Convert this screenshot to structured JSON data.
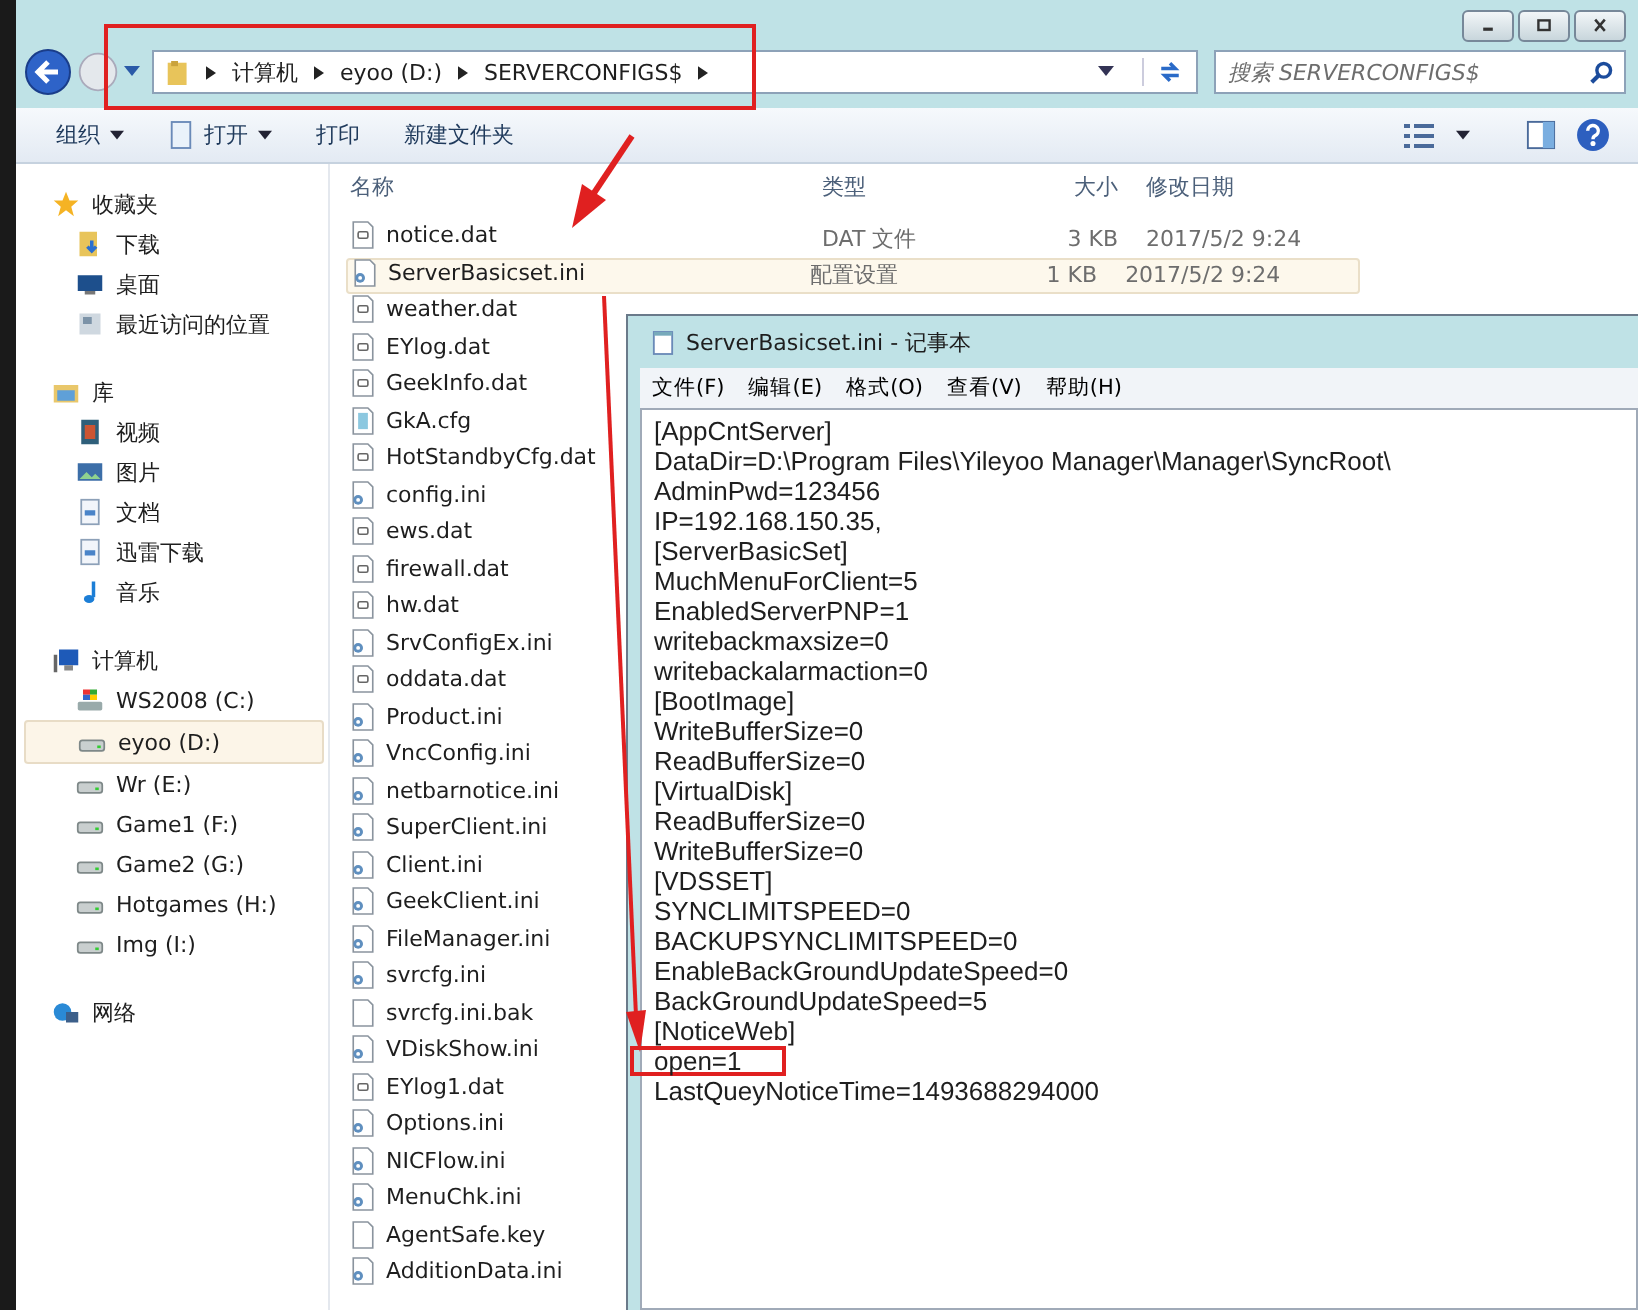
{
  "address_bar": {
    "crumbs": [
      "计算机",
      "eyoo (D:)",
      "SERVERCONFIGS$"
    ]
  },
  "search": {
    "placeholder": "搜索 SERVERCONFIGS$"
  },
  "toolbar": [
    {
      "label": "组织",
      "dropdown": true,
      "kind": "plain"
    },
    {
      "label": "打开",
      "dropdown": true,
      "kind": "open"
    },
    {
      "label": "打印",
      "dropdown": false,
      "kind": "plain"
    },
    {
      "label": "新建文件夹",
      "dropdown": false,
      "kind": "plain"
    }
  ],
  "sidebar": {
    "groups": [
      {
        "label": "收藏夹",
        "kind": "star",
        "items": [
          {
            "label": "下载",
            "kind": "download",
            "selected": false
          },
          {
            "label": "桌面",
            "kind": "desktop",
            "selected": false
          },
          {
            "label": "最近访问的位置",
            "kind": "recent",
            "selected": false
          }
        ]
      },
      {
        "label": "库",
        "kind": "library",
        "items": [
          {
            "label": "视频",
            "kind": "video",
            "selected": false
          },
          {
            "label": "图片",
            "kind": "picture",
            "selected": false
          },
          {
            "label": "文档",
            "kind": "document",
            "selected": false
          },
          {
            "label": "迅雷下载",
            "kind": "document",
            "selected": false
          },
          {
            "label": "音乐",
            "kind": "music",
            "selected": false
          }
        ]
      },
      {
        "label": "计算机",
        "kind": "computer",
        "items": [
          {
            "label": "WS2008 (C:)",
            "kind": "system-drive",
            "selected": false
          },
          {
            "label": "eyoo (D:)",
            "kind": "drive",
            "selected": true
          },
          {
            "label": "Wr (E:)",
            "kind": "drive",
            "selected": false
          },
          {
            "label": "Game1 (F:)",
            "kind": "drive",
            "selected": false
          },
          {
            "label": "Game2 (G:)",
            "kind": "drive",
            "selected": false
          },
          {
            "label": "Hotgames (H:)",
            "kind": "drive",
            "selected": false
          },
          {
            "label": "Img (I:)",
            "kind": "drive",
            "selected": false
          }
        ]
      },
      {
        "label": "网络",
        "kind": "network"
      }
    ]
  },
  "table": {
    "columns": [
      "名称",
      "类型",
      "大小",
      "修改日期"
    ],
    "rows": [
      {
        "name": "notice.dat",
        "kind": "dat",
        "type": "DAT 文件",
        "size": "3 KB",
        "date": "2017/5/2 9:24",
        "selected": false
      },
      {
        "name": "ServerBasicset.ini",
        "kind": "ini",
        "type": "配置设置",
        "size": "1 KB",
        "date": "2017/5/2 9:24",
        "selected": true
      },
      {
        "name": "weather.dat",
        "kind": "dat",
        "selected": false
      },
      {
        "name": "EYlog.dat",
        "kind": "dat",
        "selected": false
      },
      {
        "name": "GeekInfo.dat",
        "kind": "dat",
        "selected": false
      },
      {
        "name": "GkA.cfg",
        "kind": "cfg",
        "selected": false
      },
      {
        "name": "HotStandbyCfg.dat",
        "kind": "dat",
        "selected": false
      },
      {
        "name": "config.ini",
        "kind": "ini",
        "selected": false
      },
      {
        "name": "ews.dat",
        "kind": "dat",
        "selected": false
      },
      {
        "name": "firewall.dat",
        "kind": "dat",
        "selected": false
      },
      {
        "name": "hw.dat",
        "kind": "dat",
        "selected": false
      },
      {
        "name": "SrvConfigEx.ini",
        "kind": "ini",
        "selected": false
      },
      {
        "name": "oddata.dat",
        "kind": "dat",
        "selected": false
      },
      {
        "name": "Product.ini",
        "kind": "ini",
        "selected": false
      },
      {
        "name": "VncConfig.ini",
        "kind": "ini",
        "selected": false
      },
      {
        "name": "netbarnotice.ini",
        "kind": "ini",
        "selected": false
      },
      {
        "name": "SuperClient.ini",
        "kind": "ini",
        "selected": false
      },
      {
        "name": "Client.ini",
        "kind": "ini",
        "selected": false
      },
      {
        "name": "GeekClient.ini",
        "kind": "ini",
        "selected": false
      },
      {
        "name": "FileManager.ini",
        "kind": "ini",
        "selected": false
      },
      {
        "name": "svrcfg.ini",
        "kind": "ini",
        "selected": false
      },
      {
        "name": "svrcfg.ini.bak",
        "kind": "blank",
        "selected": false
      },
      {
        "name": "VDiskShow.ini",
        "kind": "ini",
        "selected": false
      },
      {
        "name": "EYlog1.dat",
        "kind": "dat",
        "selected": false
      },
      {
        "name": "Options.ini",
        "kind": "ini",
        "selected": false
      },
      {
        "name": "NICFlow.ini",
        "kind": "ini",
        "selected": false
      },
      {
        "name": "MenuChk.ini",
        "kind": "ini",
        "selected": false
      },
      {
        "name": "AgentSafe.key",
        "kind": "blank",
        "selected": false
      },
      {
        "name": "AdditionData.ini",
        "kind": "ini",
        "selected": false
      }
    ]
  },
  "notepad": {
    "title": "ServerBasicset.ini - 记事本",
    "menu": [
      "文件(F)",
      "编辑(E)",
      "格式(O)",
      "查看(V)",
      "帮助(H)"
    ],
    "lines": [
      {
        "text": "[AppCntServer]",
        "boxed": false
      },
      {
        "text": "DataDir=D:\\Program Files\\Yileyoo Manager\\Manager\\SyncRoot\\",
        "boxed": false
      },
      {
        "text": "AdminPwd=123456",
        "boxed": false
      },
      {
        "text": "IP=192.168.150.35,",
        "boxed": false
      },
      {
        "text": "[ServerBasicSet]",
        "boxed": false
      },
      {
        "text": "MuchMenuForClient=5",
        "boxed": false
      },
      {
        "text": "EnabledServerPNP=1",
        "boxed": false
      },
      {
        "text": "writebackmaxsize=0",
        "boxed": false
      },
      {
        "text": "writebackalarmaction=0",
        "boxed": false
      },
      {
        "text": "[BootImage]",
        "boxed": false
      },
      {
        "text": "WriteBufferSize=0",
        "boxed": false
      },
      {
        "text": "ReadBufferSize=0",
        "boxed": false
      },
      {
        "text": "[VirtualDisk]",
        "boxed": false
      },
      {
        "text": "ReadBufferSize=0",
        "boxed": false
      },
      {
        "text": "WriteBufferSize=0",
        "boxed": false
      },
      {
        "text": "[VDSSET]",
        "boxed": false
      },
      {
        "text": "SYNCLIMITSPEED=0",
        "boxed": false
      },
      {
        "text": "BACKUPSYNCLIMITSPEED=0",
        "boxed": false
      },
      {
        "text": "EnableBackGroundUpdateSpeed=0",
        "boxed": false
      },
      {
        "text": "BackGroundUpdateSpeed=5",
        "boxed": false
      },
      {
        "text": "[NoticeWeb]",
        "boxed": false
      },
      {
        "text": "open=1",
        "boxed": true
      },
      {
        "text": "LastQueyNoticeTime=1493688294000",
        "boxed": false
      }
    ]
  }
}
